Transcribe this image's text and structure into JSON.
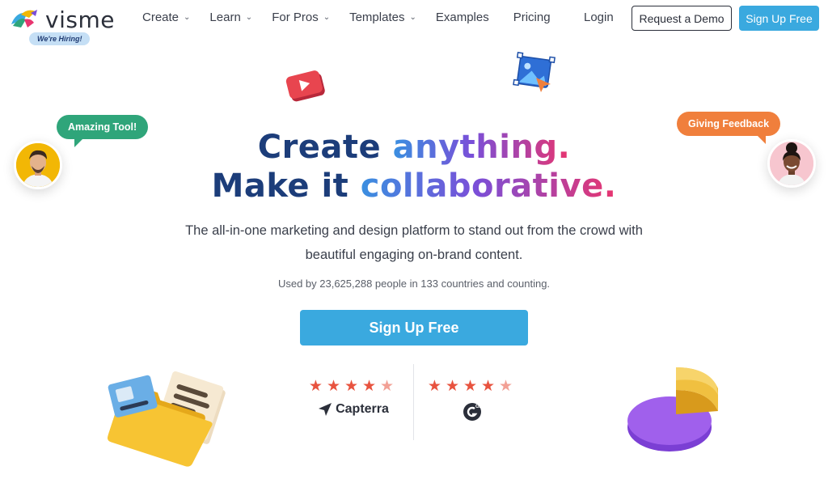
{
  "brand": {
    "name": "visme",
    "hiring_badge": "We're Hiring!"
  },
  "nav": {
    "items": [
      {
        "label": "Create",
        "dropdown": true
      },
      {
        "label": "Learn",
        "dropdown": true
      },
      {
        "label": "For Pros",
        "dropdown": true
      },
      {
        "label": "Templates",
        "dropdown": true
      },
      {
        "label": "Examples",
        "dropdown": false
      },
      {
        "label": "Pricing",
        "dropdown": false
      }
    ],
    "login": "Login",
    "request_demo": "Request a Demo",
    "signup": "Sign Up Free"
  },
  "hero": {
    "line1_a": "Create ",
    "line1_b": "anything.",
    "line2_a": "Make it ",
    "line2_b": "collaborative.",
    "subtitle": "The all-in-one marketing and design platform to stand out from the crowd with beautiful engaging on-brand content.",
    "usage": "Used by 23,625,288 people in 133 countries and counting.",
    "cta": "Sign Up Free"
  },
  "bubbles": {
    "left": "Amazing Tool!",
    "right": "Giving Feedback"
  },
  "ratings": [
    {
      "stars": 4.5,
      "label": "Capterra"
    },
    {
      "stars": 4.5,
      "label": "G2"
    }
  ],
  "colors": {
    "accent": "#3aa9df",
    "heading_dark": "#1c3d7a",
    "bubble_green": "#2fa57a",
    "bubble_orange": "#f07f3c",
    "star": "#e8533f"
  }
}
